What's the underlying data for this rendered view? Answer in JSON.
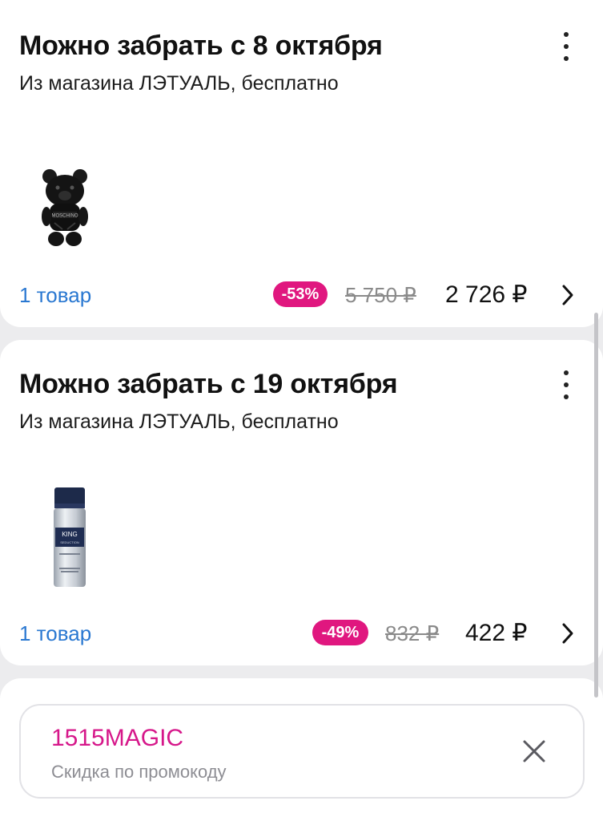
{
  "orders": [
    {
      "title": "Можно забрать с 8 октября",
      "subtitle": "Из магазина ЛЭТУАЛЬ, бесплатно",
      "product_image": "moschino-toy-boy-perfume-bottle",
      "items_count_label": "1 товар",
      "discount": "-53%",
      "old_price": "5 750 ₽",
      "new_price": "2 726 ₽"
    },
    {
      "title": "Можно забрать с 19 октября",
      "subtitle": "Из магазина ЛЭТУАЛЬ, бесплатно",
      "product_image": "king-of-seduction-deodorant-can",
      "items_count_label": "1 товар",
      "discount": "-49%",
      "old_price": "832 ₽",
      "new_price": "422 ₽"
    }
  ],
  "promo": {
    "code": "1515MAGIC",
    "label": "Скидка по промокоду"
  },
  "colors": {
    "accent_pink": "#e0177f",
    "link_blue": "#2a78d1",
    "background": "#ececee"
  },
  "icons": [
    "more-vertical-icon",
    "chevron-right-icon",
    "close-icon"
  ]
}
